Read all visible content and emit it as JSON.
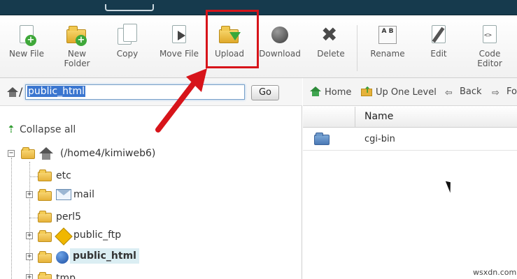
{
  "toolbar": {
    "items": [
      {
        "label": "New File",
        "icon": "new-file-icon"
      },
      {
        "label": "New\nFolder",
        "icon": "new-folder-icon"
      },
      {
        "label": "Copy",
        "icon": "copy-icon"
      },
      {
        "label": "Move File",
        "icon": "move-file-icon"
      },
      {
        "label": "Upload",
        "icon": "upload-icon"
      },
      {
        "label": "Download",
        "icon": "download-icon"
      },
      {
        "label": "Delete",
        "icon": "delete-icon"
      },
      {
        "label": "Rename",
        "icon": "rename-icon"
      },
      {
        "label": "Edit",
        "icon": "edit-icon"
      },
      {
        "label": "Code\nEditor",
        "icon": "code-editor-icon"
      }
    ],
    "rename_glyph": "A B",
    "code_glyph": "<>",
    "highlight_color": "#d7141a"
  },
  "pathbar": {
    "slash": "/",
    "path_value": "public_html",
    "go_label": "Go"
  },
  "tree": {
    "collapse_label": "Collapse all",
    "root_label": "(/home4/kimiweb6)",
    "items": [
      {
        "label": "etc"
      },
      {
        "label": "mail"
      },
      {
        "label": "perl5"
      },
      {
        "label": "public_ftp"
      },
      {
        "label": "public_html"
      },
      {
        "label": "tmp"
      }
    ]
  },
  "nav": {
    "home": "Home",
    "up": "Up One Level",
    "back": "Back",
    "forward": "Fo"
  },
  "file_table": {
    "column_name": "Name",
    "rows": [
      {
        "name": "cgi-bin",
        "icon": "folder-icon"
      }
    ]
  },
  "watermark": "wsxdn.com"
}
